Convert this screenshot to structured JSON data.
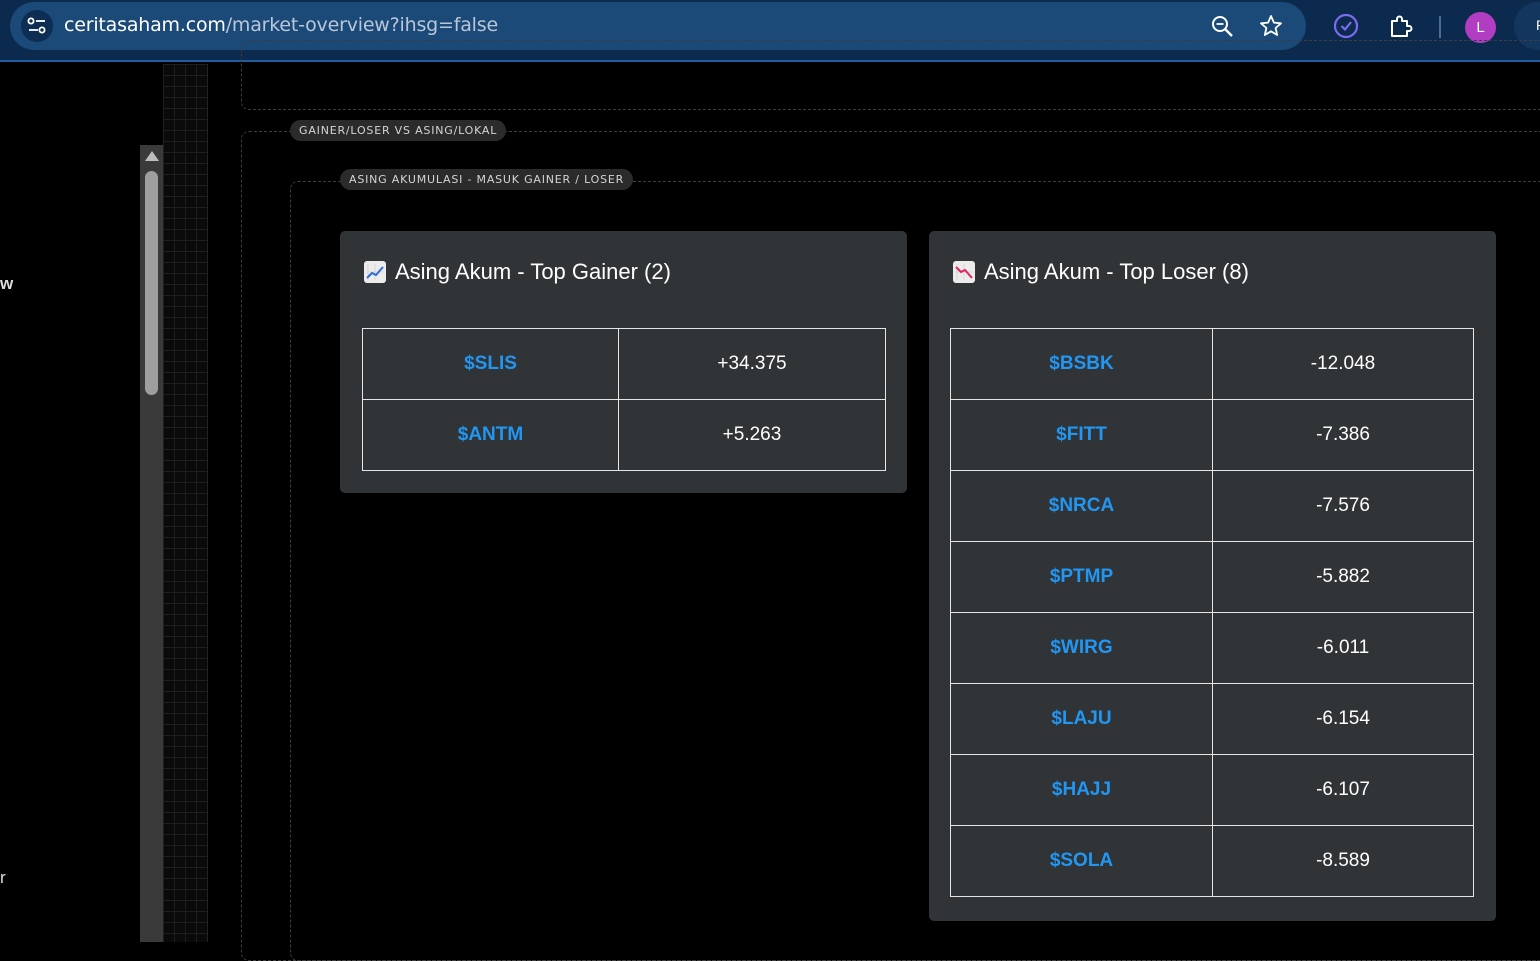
{
  "browser": {
    "url_host": "ceritasaham.com",
    "url_path": "/market-overview?ihsg=false",
    "profile_initial": "L",
    "edge_button_label": "P"
  },
  "left_panel": {
    "fragments": [
      "w",
      "r"
    ]
  },
  "sections": {
    "outer_label": "GAINER/LOSER VS ASING/LOKAL",
    "inner_label": "ASING AKUMULASI - MASUK GAINER / LOSER"
  },
  "gainer_card": {
    "title": "Asing Akum - Top Gainer (2)",
    "icon": "chart-increasing-icon",
    "rows": [
      {
        "ticker": "$SLIS",
        "value": "+34.375"
      },
      {
        "ticker": "$ANTM",
        "value": "+5.263"
      }
    ]
  },
  "loser_card": {
    "title": "Asing Akum - Top Loser (8)",
    "icon": "chart-decreasing-icon",
    "rows": [
      {
        "ticker": "$BSBK",
        "value": "-12.048"
      },
      {
        "ticker": "$FITT",
        "value": "-7.386"
      },
      {
        "ticker": "$NRCA",
        "value": "-7.576"
      },
      {
        "ticker": "$PTMP",
        "value": "-5.882"
      },
      {
        "ticker": "$WIRG",
        "value": "-6.011"
      },
      {
        "ticker": "$LAJU",
        "value": "-6.154"
      },
      {
        "ticker": "$HAJJ",
        "value": "-6.107"
      },
      {
        "ticker": "$SOLA",
        "value": "-8.589"
      }
    ]
  },
  "colors": {
    "ticker_link": "#2196f3",
    "card_bg": "#313436",
    "chrome_bg": "#0b2a4d"
  }
}
